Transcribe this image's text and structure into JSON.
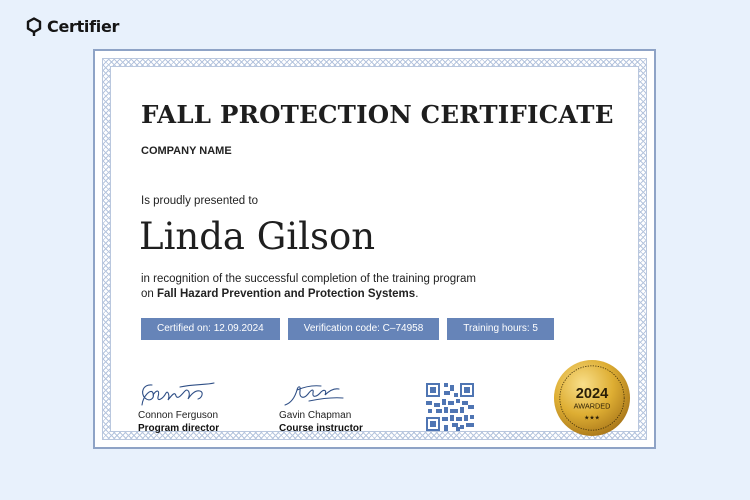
{
  "brand": {
    "name": "Certifier",
    "icon": "certifier-logo-icon"
  },
  "certificate": {
    "title": "FALL PROTECTION CERTIFICATE",
    "company": "COMPANY NAME",
    "presented_text": "Is proudly presented to",
    "recipient": "Linda Gilson",
    "description_line1": "in recognition of the successful completion of the training program",
    "description_prefix": "on ",
    "program": "Fall Hazard Prevention and Protection Systems",
    "description_suffix": ".",
    "badges": {
      "certified_on": "Certified on: 12.09.2024",
      "verification": "Verification code: C–74958",
      "hours": "Training hours: 5"
    },
    "signatures": [
      {
        "name": "Connon Ferguson",
        "role": "Program director"
      },
      {
        "name": "Gavin Chapman",
        "role": "Course instructor"
      }
    ],
    "qr_icon": "qr-code-icon",
    "seal": {
      "year": "2024",
      "label": "AWARDED",
      "stars": "★★★"
    }
  },
  "colors": {
    "background": "#e8f1fc",
    "border": "#8ea3c6",
    "badge": "#6684b8",
    "gold": "#d9a92a"
  }
}
